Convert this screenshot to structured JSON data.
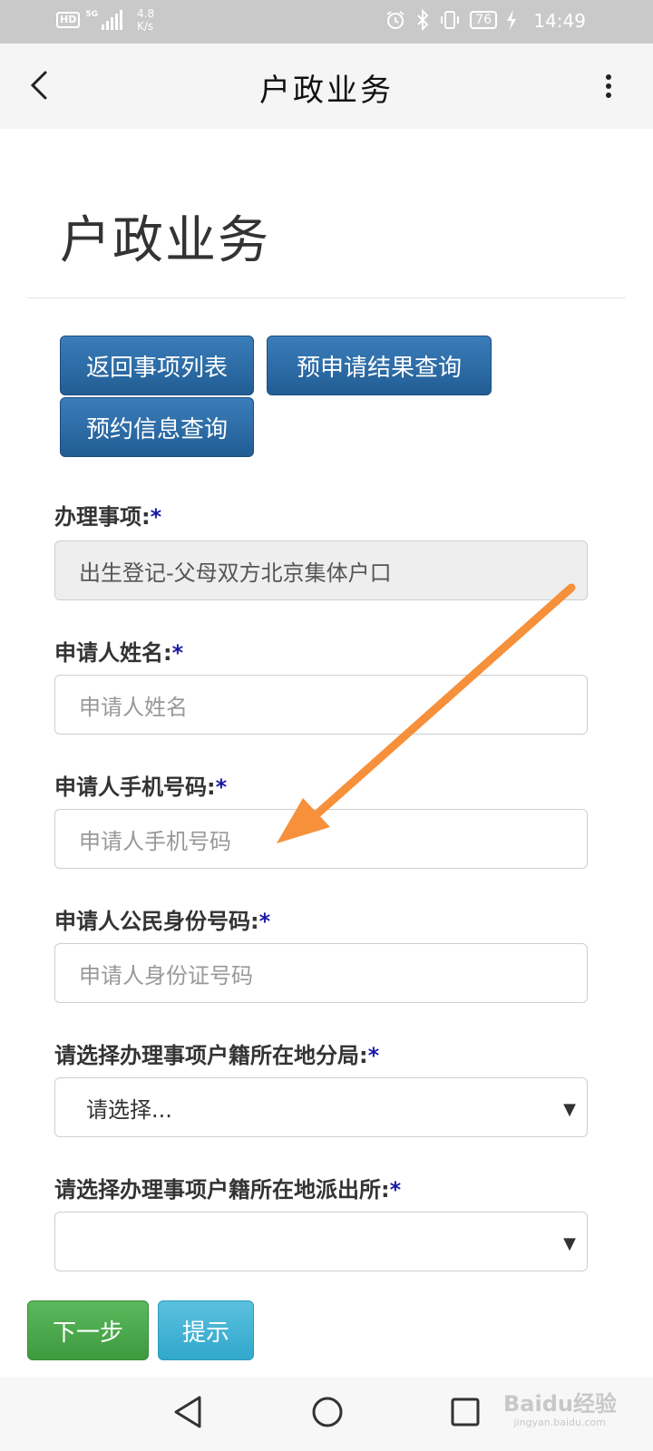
{
  "status_bar": {
    "hd": "HD",
    "signal_label": "5G",
    "net_speed_value": "4.8",
    "net_speed_unit": "K/s",
    "battery": "76",
    "time": "14:49"
  },
  "app_bar": {
    "title": "户政业务"
  },
  "page": {
    "heading": "户政业务"
  },
  "action_buttons": {
    "back_to_list": "返回事项列表",
    "pre_apply_query": "预申请结果查询",
    "appointment_query": "预约信息查询"
  },
  "form": {
    "required_mark": "*",
    "item": {
      "label": "办理事项:",
      "value": "出生登记-父母双方北京集体户口"
    },
    "applicant_name": {
      "label": "申请人姓名:",
      "placeholder": "申请人姓名"
    },
    "applicant_phone": {
      "label": "申请人手机号码:",
      "placeholder": "申请人手机号码"
    },
    "applicant_id": {
      "label": "申请人公民身份号码:",
      "placeholder": "申请人身份证号码"
    },
    "branch_bureau": {
      "label": "请选择办理事项户籍所在地分局:",
      "selected": "请选择..."
    },
    "police_station": {
      "label": "请选择办理事项户籍所在地派出所:",
      "selected": ""
    }
  },
  "footer_buttons": {
    "next": "下一步",
    "hint": "提示"
  },
  "watermark": {
    "text": "Baidu经验",
    "sub": "jingyan.baidu.com"
  },
  "colors": {
    "primary_blue": "#2a6aa8",
    "success_green": "#4cae4c",
    "info_cyan": "#46b8da",
    "annotation_arrow": "#f7903a"
  }
}
